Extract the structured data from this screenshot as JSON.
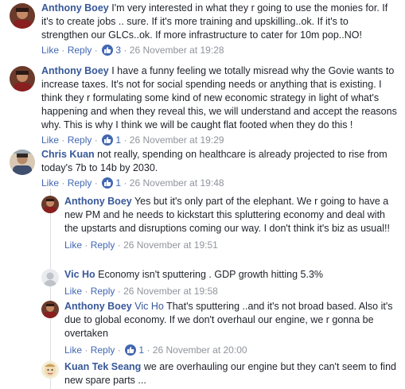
{
  "comments": [
    {
      "author": "Anthony Boey",
      "text": "I'm very interested in what they r going to use the monies for. If it's to create jobs .. sure. If it's more training and upskilling..ok. If it's to strengthen our GLCs..ok. If more infrastructure to cater for 10m pop..NO!",
      "like": "Like",
      "reply": "Reply",
      "likes": "3",
      "time": "26 November at 19:28"
    },
    {
      "author": "Anthony Boey",
      "text": "I have a funny feeling we totally misread why the Govie wants to increase taxes. It's not for social spending needs or anything that is existing. I think they r formulating some kind of new economic strategy in light of what's happening and when they reveal this, we will understand and accept the reasons why. This is why I think we will be caught flat footed when they do this !",
      "like": "Like",
      "reply": "Reply",
      "likes": "1",
      "time": "26 November at 19:29"
    },
    {
      "author": "Chris Kuan",
      "text": "not really, spending on healthcare is already projected to rise from today's 7b to 14b by 2030.",
      "like": "Like",
      "reply": "Reply",
      "likes": "1",
      "time": "26 November at 19:48"
    }
  ],
  "replies": [
    {
      "author": "Anthony Boey",
      "text": "Yes but it's only part of the elephant. We r going to have a new PM and he needs to kickstart this spluttering economy and deal with the upstarts and disruptions coming our way. I don't think it's biz as usual!!",
      "like": "Like",
      "reply": "Reply",
      "time": "26 November at 19:51"
    },
    {
      "author": "Vic Ho",
      "text": "Economy isn't sputtering . GDP growth hitting 5.3%",
      "like": "Like",
      "reply": "Reply",
      "time": "26 November at 19:58"
    },
    {
      "author": "Anthony Boey",
      "mention": "Vic Ho",
      "text": "That's sputtering ..and it's not broad based. Also it's due to global economy. If we don't overhaul our engine, we r gonna be overtaken",
      "like": "Like",
      "reply": "Reply",
      "likes": "1",
      "time": "26 November at 20:00"
    },
    {
      "author": "Kuan Tek Seang",
      "text": "we are overhauling our engine but they can't seem to find new spare parts ..."
    }
  ],
  "separator": "·",
  "colors": {
    "link": "#385898",
    "action": "#4267b2",
    "meta": "#90949c",
    "badge": "#4267b2"
  }
}
